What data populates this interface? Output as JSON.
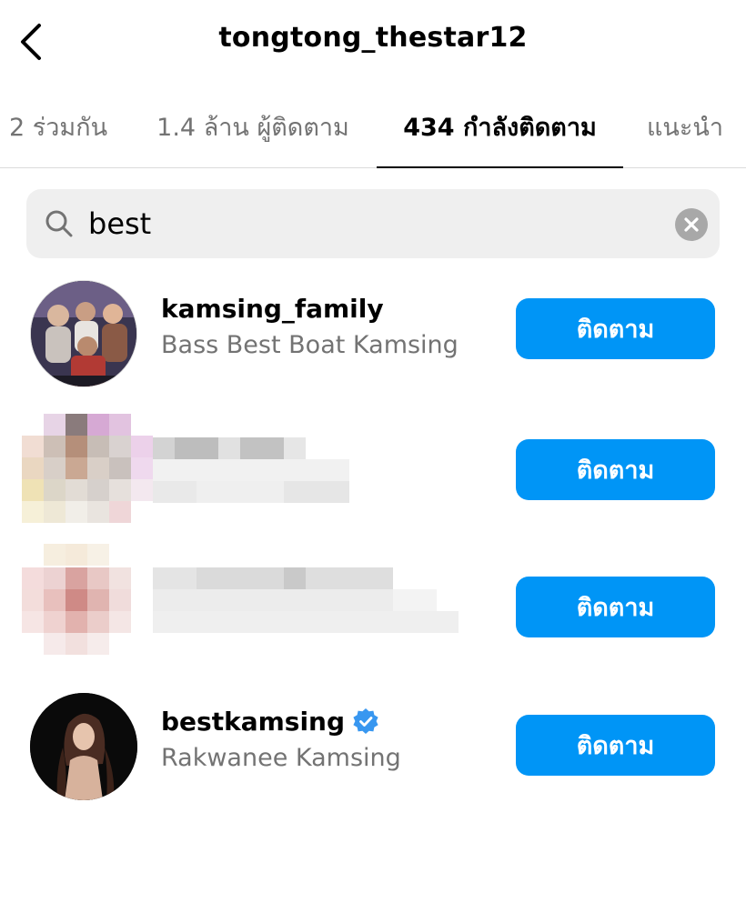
{
  "header": {
    "title": "tongtong_thestar12"
  },
  "tabs": [
    {
      "label": "2 ร่วมกัน",
      "active": false
    },
    {
      "label": "1.4 ล้าน ผู้ติดตาม",
      "active": false
    },
    {
      "label": "434 กำลังติดตาม",
      "active": true
    },
    {
      "label": "แนะนำ",
      "active": false
    }
  ],
  "search": {
    "value": "best"
  },
  "results": [
    {
      "username": "kamsing_family",
      "fullname": "Bass Best Boat Kamsing",
      "verified": false,
      "button": "ติดตาม"
    },
    {
      "username": "",
      "fullname": "",
      "blurred": true,
      "button": "ติดตาม"
    },
    {
      "username": "",
      "fullname": "",
      "blurred": true,
      "button": "ติดตาม"
    },
    {
      "username": "bestkamsing",
      "fullname": "Rakwanee Kamsing",
      "verified": true,
      "button": "ติดตาม"
    }
  ],
  "colors": {
    "accent": "#0095f6",
    "verified": "#3897f0",
    "muted": "#737373"
  }
}
